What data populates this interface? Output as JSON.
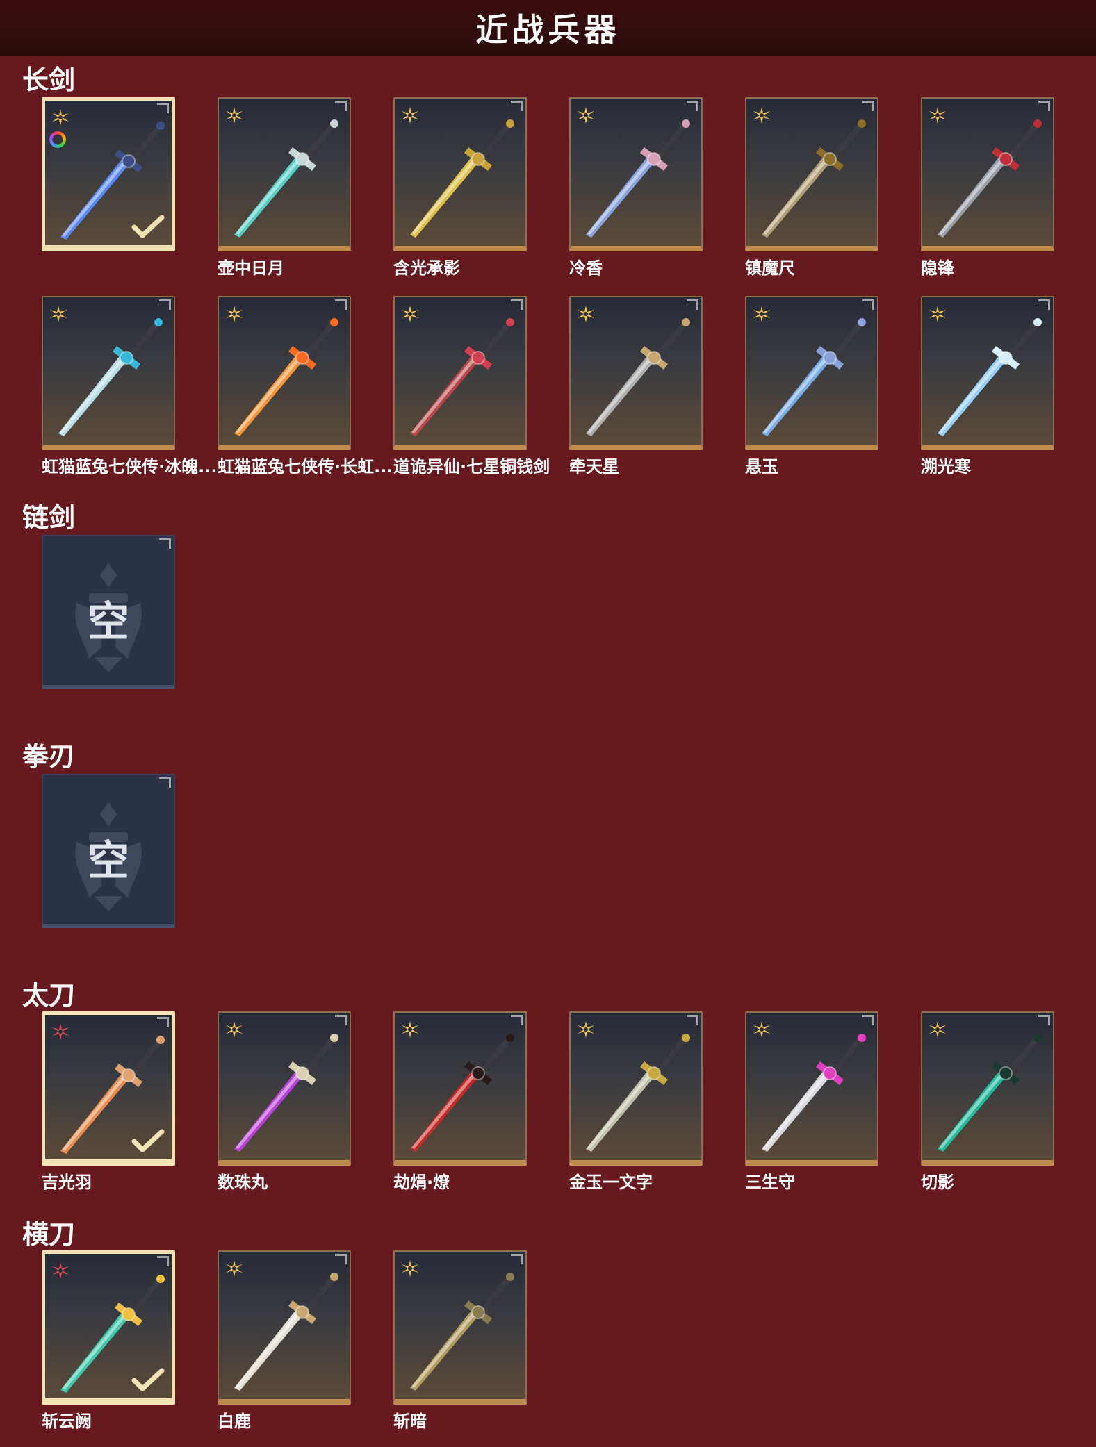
{
  "header": {
    "title": "近战兵器"
  },
  "sections": {
    "longsword": {
      "label": "长剑",
      "items": [
        {
          "name": "",
          "rarity": "gold",
          "selected": true,
          "colorful": true,
          "blade": "#5a8cff",
          "guard": "#3b4f86"
        },
        {
          "name": "壶中日月",
          "rarity": "gold",
          "blade": "#58d6cf",
          "guard": "#c9d7d6"
        },
        {
          "name": "含光承影",
          "rarity": "gold",
          "blade": "#e6c64a",
          "guard": "#c9a239"
        },
        {
          "name": "冷香",
          "rarity": "gold",
          "blade": "#8ea9e6",
          "guard": "#d8a0b6"
        },
        {
          "name": "镇魔尺",
          "rarity": "gold",
          "blade": "#b8a47a",
          "guard": "#8c6e2c"
        },
        {
          "name": "隐锋",
          "rarity": "gold",
          "blade": "#9ea4ad",
          "guard": "#c0303a"
        },
        {
          "name": "虹猫蓝兔七侠传·冰魄...",
          "rarity": "gold",
          "blade": "#bfe7ee",
          "guard": "#38b8d8"
        },
        {
          "name": "虹猫蓝兔七侠传·长虹...",
          "rarity": "gold",
          "blade": "#ff9a3a",
          "guard": "#ff6a20"
        },
        {
          "name": "道诡异仙·七星铜钱剑",
          "rarity": "gold",
          "blade": "#c0484a",
          "guard": "#d04050"
        },
        {
          "name": "牵天星",
          "rarity": "gold",
          "blade": "#b4b4b4",
          "guard": "#c8a870"
        },
        {
          "name": "悬玉",
          "rarity": "gold",
          "blade": "#7ab2f0",
          "guard": "#8aa0d8"
        },
        {
          "name": "溯光寒",
          "rarity": "gold",
          "blade": "#9cd6ff",
          "guard": "#d6efff"
        }
      ]
    },
    "chainsword": {
      "label": "链剑",
      "empty_text": "空"
    },
    "fistblade": {
      "label": "拳刃",
      "empty_text": "空"
    },
    "katana": {
      "label": "太刀",
      "items": [
        {
          "name": "吉光羽",
          "rarity": "red",
          "selected": true,
          "blade": "#f09050",
          "guard": "#e0a070"
        },
        {
          "name": "数珠丸",
          "rarity": "gold",
          "blade": "#c040e0",
          "guard": "#d8d0b0"
        },
        {
          "name": "劫焆·燎",
          "rarity": "gold",
          "blade": "#d02828",
          "guard": "#2a1a1a"
        },
        {
          "name": "金玉一文字",
          "rarity": "gold",
          "blade": "#c8c8b0",
          "guard": "#c8a840"
        },
        {
          "name": "三生守",
          "rarity": "gold",
          "blade": "#e0e0e8",
          "guard": "#e040c0"
        },
        {
          "name": "切影",
          "rarity": "gold",
          "blade": "#20c0a0",
          "guard": "#1a3a30"
        }
      ]
    },
    "dao": {
      "label": "横刀",
      "items": [
        {
          "name": "斩云阙",
          "rarity": "red",
          "selected": true,
          "blade": "#40d0b0",
          "guard": "#f0c040"
        },
        {
          "name": "白鹿",
          "rarity": "gold",
          "blade": "#ece8da",
          "guard": "#c8a870"
        },
        {
          "name": "斩暗",
          "rarity": "gold",
          "blade": "#b8a060",
          "guard": "#8a7a50"
        }
      ]
    }
  },
  "colors": {
    "gold_star": "#f2c25b",
    "red_star": "#e0505a",
    "check": "#f3e2b3"
  }
}
